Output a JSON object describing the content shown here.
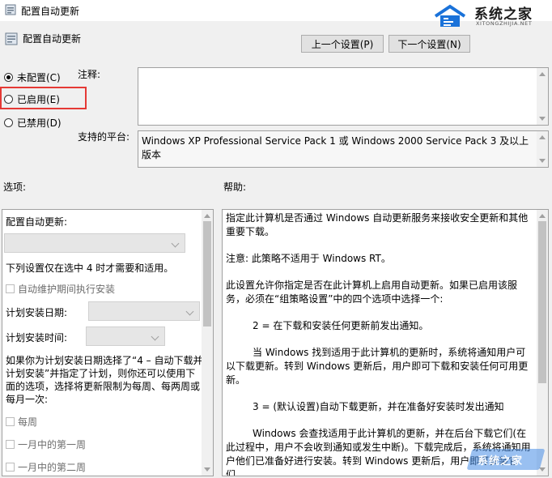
{
  "window": {
    "title": "配置自动更新"
  },
  "watermark": {
    "logo_text": "系统之家",
    "logo_sub": "XITONGZHIJIA.NET",
    "corner_text": "系统之家"
  },
  "header": {
    "policy_title": "配置自动更新",
    "prev_button": "上一个设置(P)",
    "next_button": "下一个设置(N)"
  },
  "state": {
    "not_configured": "未配置(C)",
    "enabled": "已启用(E)",
    "disabled": "已禁用(D)",
    "selected": "not_configured"
  },
  "comment": {
    "label": "注释:",
    "value": ""
  },
  "platform": {
    "label": "支持的平台:",
    "value": "Windows XP Professional Service Pack 1 或 Windows 2000 Service Pack 3 及以上版本"
  },
  "options": {
    "section_label": "选项:",
    "configure_label": "配置自动更新:",
    "configure_value": "",
    "note": "下列设置仅在选中 4 时才需要和适用。",
    "auto_maintenance": "自动维护期间执行安装",
    "schedule_day_label": "计划安装日期:",
    "schedule_time_label": "计划安装时间:",
    "paragraph": "如果你为计划安装日期选择了“4 – 自动下载并计划安装”并指定了计划，则你还可以使用下面的选项，选择将更新限制为每周、每两周或每月一次:",
    "every_week": "每周",
    "first_week": "一月中的第一周",
    "second_week": "一月中的第二周"
  },
  "help": {
    "section_label": "帮助:",
    "paragraphs": [
      "指定此计算机是否通过 Windows 自动更新服务来接收安全更新和其他重要下载。",
      "注意: 此策略不适用于 Windows RT。",
      "此设置允许你指定是否在此计算机上启用自动更新。如果已启用该服务，必须在“组策略设置”中的四个选项中选择一个:",
      "2 = 在下载和安装任何更新前发出通知。",
      "当 Windows 找到适用于此计算机的更新时，系统将通知用户可以下载更新。转到 Windows 更新后，用户即可下载和安装任何可用更新。",
      "3 = (默认设置)自动下载更新，并在准备好安装时发出通知",
      "Windows 会查找适用于此计算机的更新，并在后台下载它们(在此过程中，用户不会收到通知或发生中断)。下载完成后，系统将通知用户他们已准备好进行安装。转到 Windows 更新后，用户即可安装它们。"
    ]
  }
}
